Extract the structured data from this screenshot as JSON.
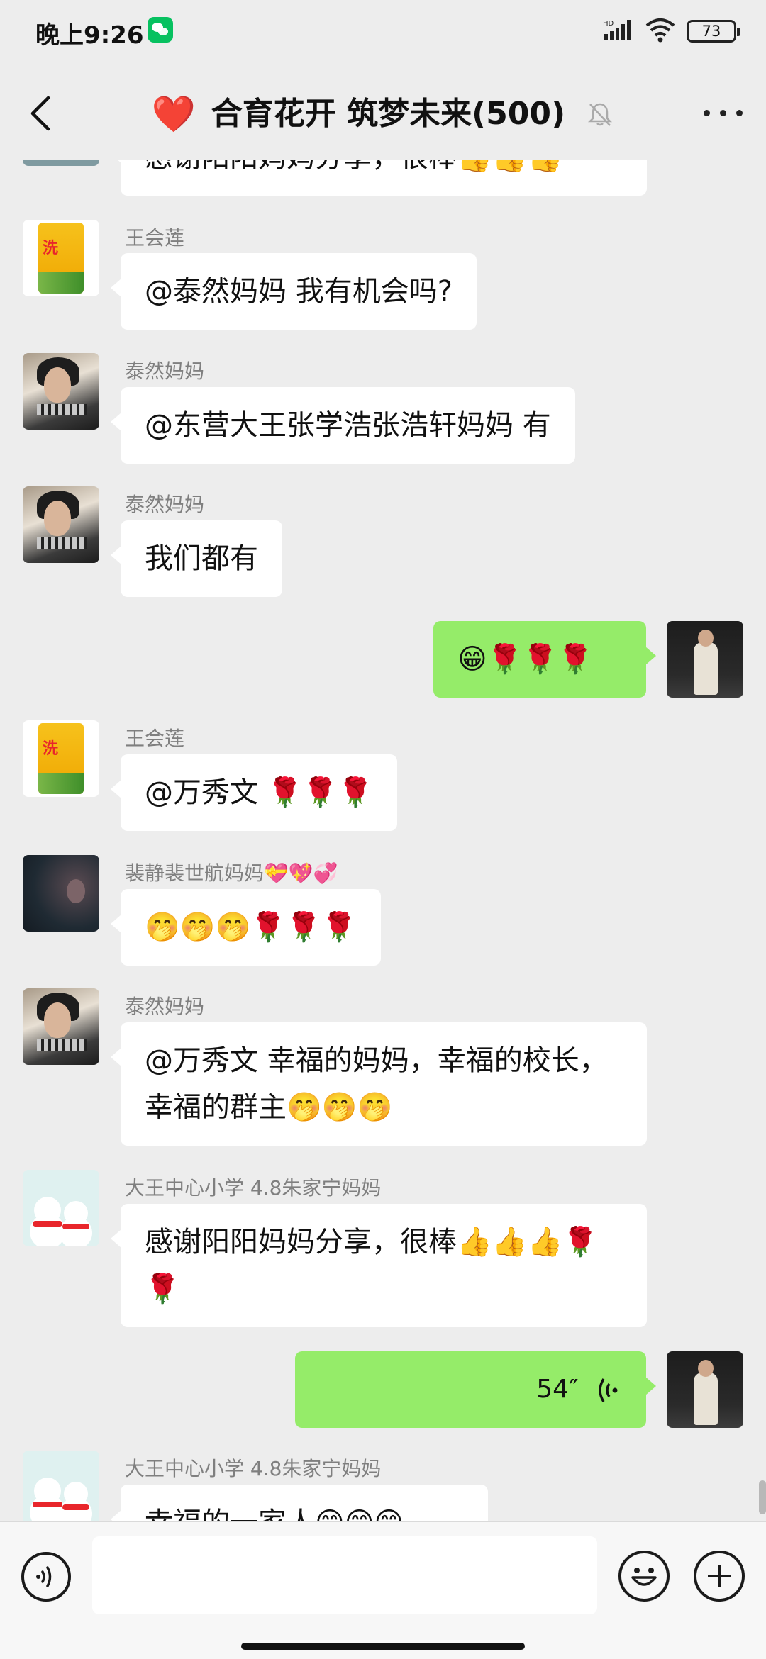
{
  "status_bar": {
    "time": "晚上9:26",
    "signal_label": "HD",
    "battery": "73"
  },
  "header": {
    "heart_emoji": "❤️",
    "title": "合育花开 筑梦未来(500)"
  },
  "messages": [
    {
      "kind": "partial",
      "sender": "",
      "text": "感谢阳阳妈妈分享，很棒👍👍👍"
    },
    {
      "kind": "left",
      "sender": "王会莲",
      "avatar": "rice-bag-avatar",
      "text": "@泰然妈妈  我有机会吗?"
    },
    {
      "kind": "left",
      "sender": "泰然妈妈",
      "avatar": "woman-avatar",
      "text": "@东营大王张学浩张浩轩妈妈  有"
    },
    {
      "kind": "left",
      "sender": "泰然妈妈",
      "avatar": "woman-avatar",
      "text": "我们都有"
    },
    {
      "kind": "mine",
      "sender": "",
      "avatar": "my-avatar",
      "text": "😁🌹🌹🌹"
    },
    {
      "kind": "left",
      "sender": "王会莲",
      "avatar": "rice-bag-avatar",
      "text": "@万秀文  🌹🌹🌹"
    },
    {
      "kind": "left",
      "sender": "裴静裴世航妈妈💝💖💞",
      "avatar": "dark-photo-avatar",
      "text": "🤭🤭🤭🌹🌹🌹"
    },
    {
      "kind": "left",
      "sender": "泰然妈妈",
      "avatar": "woman-avatar",
      "text": "@万秀文  幸福的妈妈，幸福的校长，幸福的群主🤭🤭🤭"
    },
    {
      "kind": "left",
      "sender": "大王中心小学 4.8朱家宁妈妈",
      "avatar": "snowman-avatar",
      "text": "感谢阳阳妈妈分享，很棒👍👍👍🌹🌹"
    },
    {
      "kind": "voice",
      "sender": "",
      "avatar": "my-avatar",
      "duration": "54″"
    },
    {
      "kind": "left",
      "sender": "大王中心小学 4.8朱家宁妈妈",
      "avatar": "snowman-avatar",
      "text": "幸福的一家人😊😊😊"
    }
  ],
  "input": {
    "value": "",
    "placeholder": ""
  },
  "colors": {
    "background": "#ededed",
    "my_bubble": "#95ec69",
    "other_bubble": "#ffffff",
    "name_text": "#7f7f7f",
    "heart": "#e8262b"
  }
}
